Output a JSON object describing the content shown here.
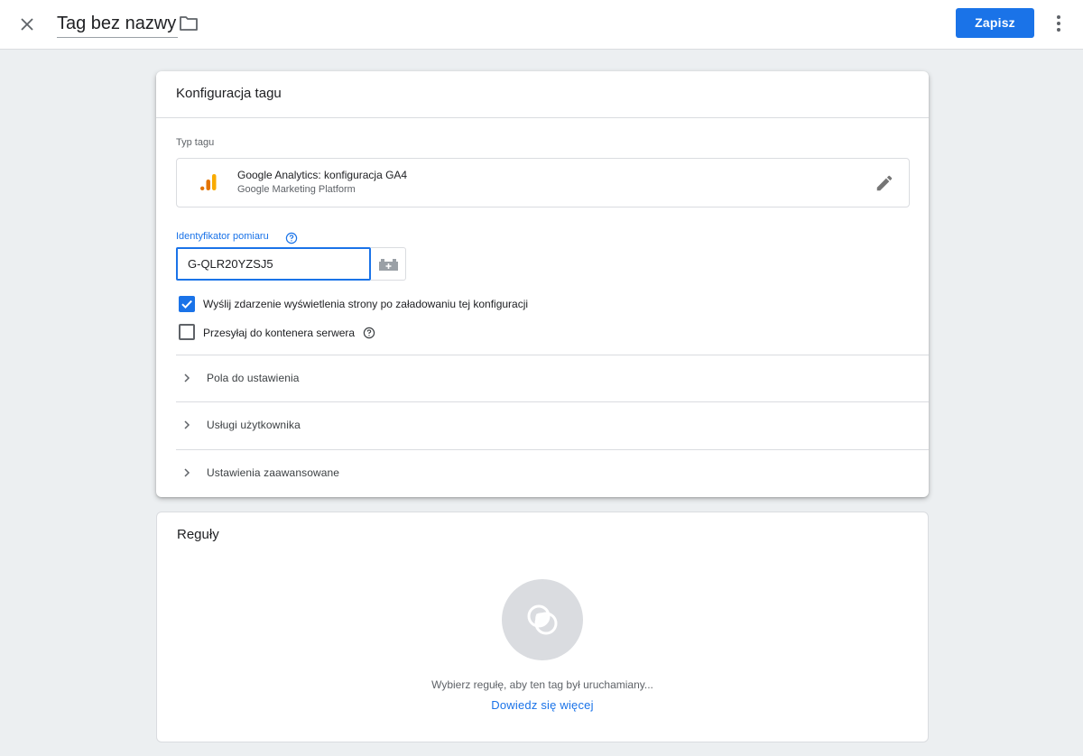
{
  "header": {
    "title": "Tag bez nazwy",
    "save_label": "Zapisz"
  },
  "config_card": {
    "title": "Konfiguracja tagu",
    "tag_type_label": "Typ tagu",
    "tag_type": {
      "name": "Google Analytics: konfiguracja GA4",
      "platform": "Google Marketing Platform"
    },
    "measurement_id_label": "Identyfikator pomiaru",
    "measurement_id_value": "G-QLR20YZSJ5",
    "checkboxes": [
      {
        "label": "Wyślij zdarzenie wyświetlenia strony po załadowaniu tej konfiguracji",
        "checked": true
      },
      {
        "label": "Przesyłaj do kontenera serwera",
        "checked": false
      }
    ],
    "sections": [
      {
        "label": "Pola do ustawienia"
      },
      {
        "label": "Usługi użytkownika"
      },
      {
        "label": "Ustawienia zaawansowane"
      }
    ]
  },
  "rules_card": {
    "title": "Reguły",
    "hint": "Wybierz regułę, aby ten tag był uruchamiany...",
    "learn_more": "Dowiedz się więcej"
  },
  "colors": {
    "accent": "#1a73e8",
    "ga_orange": "#f9ab00",
    "ga_dark_orange": "#e37400"
  },
  "icons": [
    "close-icon",
    "folder-icon",
    "more-vert-icon",
    "ga-logo-icon",
    "edit-pencil-icon",
    "help-icon",
    "variable-brick-icon",
    "chevron-right-icon",
    "trigger-icon"
  ]
}
